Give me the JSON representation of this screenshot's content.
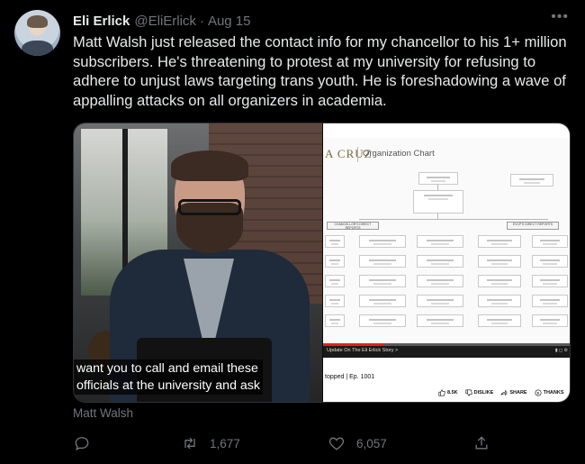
{
  "author": {
    "name": "Eli Erlick",
    "handle": "@EliErlick",
    "separator": "·",
    "date": "Aug 15"
  },
  "more_label": "•••",
  "tweet_text": "Matt Walsh just released the contact info for my chancellor to his 1+ million subscribers. He's threatening to protest at my university for refusing to adhere to unjust laws targeting trans youth. He is foreshadowing a wave of appalling attacks on all organizers in academia.",
  "media": {
    "caption_line1": "want you to call and email these",
    "caption_line2": "officials at the university and ask",
    "org_logo": "A CRUZ",
    "org_title": "Organization Chart",
    "left_report_label": "CHANCELLOR'S DIRECT REPORTS",
    "right_report_label": "EVCP'S DIRECT REPORTS",
    "update_text": "Update On The Eli Erlick Story >",
    "video_title": "topped | Ep. 1001",
    "like_count": "8.5K",
    "dislike_label": "DISLIKE",
    "share_label": "SHARE",
    "thanks_label": "THANKS",
    "author_label": "Matt Walsh"
  },
  "actions": {
    "reply_icon": "reply-icon",
    "retweet_icon": "retweet-icon",
    "retweets": "1,677",
    "like_icon": "heart-icon",
    "likes": "6,057",
    "share_icon": "share-icon"
  },
  "colors": {
    "background": "#000000",
    "text": "#e7e9ea",
    "muted": "#71767b",
    "progress": "#e62117"
  }
}
